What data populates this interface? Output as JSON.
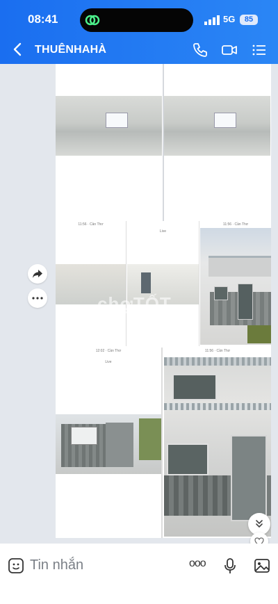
{
  "status_bar": {
    "time": "08:41",
    "network": "5G",
    "battery": "85"
  },
  "header": {
    "title": "THUÊNHAHÀ"
  },
  "icons": {
    "back": "chevron-left-icon",
    "call": "phone-icon",
    "video": "video-camera-icon",
    "menu": "list-menu-icon",
    "forward": "share-forward-icon",
    "more": "more-dots-icon",
    "scroll_down": "double-chevron-down-icon",
    "heart": "heart-icon",
    "sticker": "sticker-face-icon",
    "options": "more-options-icon",
    "mic": "microphone-icon",
    "image": "image-icon"
  },
  "message": {
    "screenshots": [
      {
        "caption_top": "",
        "city": ""
      },
      {
        "caption_top": "11:56 · Cần Thơ",
        "city": "Cần Thơ"
      },
      {
        "caption_top": "12:02 · Cần Thơ",
        "city": "Cần Thơ"
      },
      {
        "caption_top": "11:56 · Cần Thơ",
        "city": "Cần Thơ"
      }
    ],
    "live_label": "Live",
    "watermark": "chợTỐT"
  },
  "input": {
    "placeholder": "Tin nhắn",
    "options_label": "ooo"
  },
  "colors": {
    "header_start": "#1a6ef0",
    "header_end": "#2b86f5",
    "chat_bg": "#e3e7ed"
  }
}
